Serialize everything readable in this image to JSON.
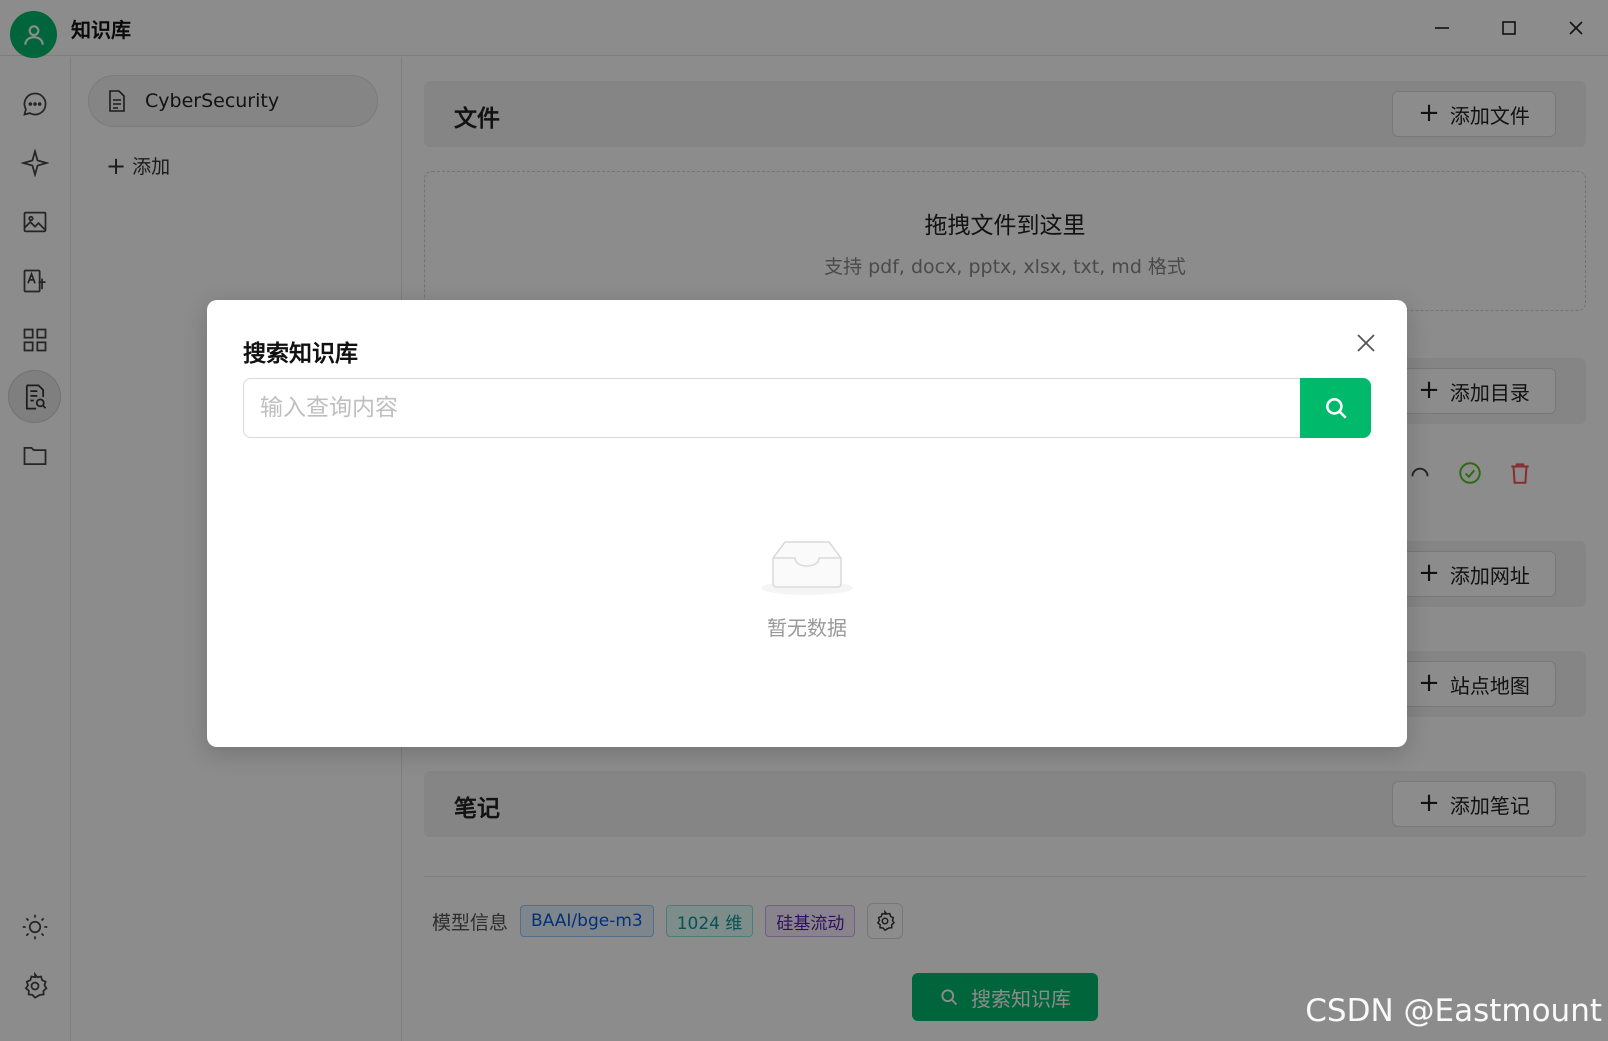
{
  "app": {
    "title": "知识库",
    "watermark": "CSDN @Eastmount"
  },
  "knowledge_list": {
    "items": [
      {
        "label": "CyberSecurity"
      }
    ],
    "add_label": "添加"
  },
  "sections": {
    "files": {
      "title": "文件",
      "button": "添加文件"
    },
    "dropzone": {
      "title": "拖拽文件到这里",
      "subtitle": "支持 pdf, docx, pptx, xlsx, txt, md 格式"
    },
    "directory": {
      "button": "添加目录"
    },
    "url": {
      "button": "添加网址"
    },
    "sitemap": {
      "button": "站点地图"
    },
    "notes": {
      "title": "笔记",
      "button": "添加笔记"
    }
  },
  "model_info": {
    "label": "模型信息",
    "tags": [
      "BAAI/bge-m3",
      "1024 维",
      "硅基流动"
    ]
  },
  "search_kb_button": "搜索知识库",
  "modal": {
    "title": "搜索知识库",
    "search_placeholder": "输入查询内容",
    "search_value": "",
    "empty_text": "暂无数据"
  },
  "colors": {
    "accent": "#00b96b",
    "overlay": "rgba(0,0,0,0.45)",
    "danger": "#ff4d4f"
  }
}
